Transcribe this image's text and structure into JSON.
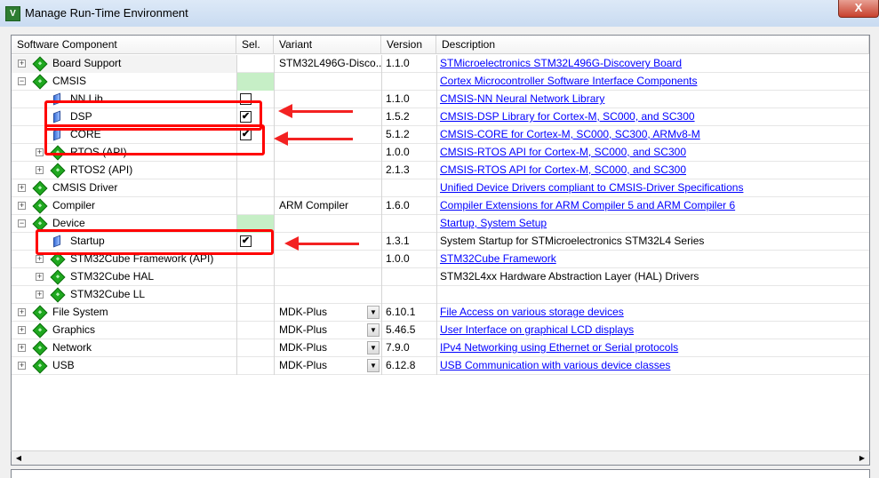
{
  "window": {
    "title": "Manage Run-Time Environment",
    "close_label": "X"
  },
  "columns": {
    "component": "Software Component",
    "sel": "Sel.",
    "variant": "Variant",
    "version": "Version",
    "description": "Description"
  },
  "rows": [
    {
      "name": "Board Support",
      "variant": "STM32L496G-Disco...",
      "version": "1.1.0",
      "description": "STMicroelectronics STM32L496G-Discovery Board",
      "link": true
    },
    {
      "name": "CMSIS",
      "variant": "",
      "version": "",
      "description": "Cortex Microcontroller Software Interface Components",
      "link": true
    },
    {
      "name": "NN Lib",
      "variant": "",
      "version": "1.1.0",
      "description": "CMSIS-NN Neural Network Library",
      "link": true
    },
    {
      "name": "DSP",
      "variant": "",
      "version": "1.5.2",
      "description": "CMSIS-DSP Library for Cortex-M, SC000, and SC300",
      "link": true,
      "checked": true
    },
    {
      "name": "CORE",
      "variant": "",
      "version": "5.1.2",
      "description": "CMSIS-CORE for Cortex-M, SC000, SC300, ARMv8-M",
      "link": true,
      "checked": true
    },
    {
      "name": "RTOS (API)",
      "variant": "",
      "version": "1.0.0",
      "description": "CMSIS-RTOS API for Cortex-M, SC000, and SC300",
      "link": true
    },
    {
      "name": "RTOS2 (API)",
      "variant": "",
      "version": "2.1.3",
      "description": "CMSIS-RTOS API for Cortex-M, SC000, and SC300",
      "link": true
    },
    {
      "name": "CMSIS Driver",
      "variant": "",
      "version": "",
      "description": "Unified Device Drivers compliant to CMSIS-Driver Specifications",
      "link": true
    },
    {
      "name": "Compiler",
      "variant": "ARM Compiler",
      "version": "1.6.0",
      "description": "Compiler Extensions for ARM Compiler 5 and ARM Compiler 6",
      "link": true
    },
    {
      "name": "Device",
      "variant": "",
      "version": "",
      "description": "Startup, System Setup",
      "link": true
    },
    {
      "name": "Startup",
      "variant": "",
      "version": "1.3.1",
      "description": "System Startup for STMicroelectronics STM32L4 Series",
      "link": false,
      "checked": true
    },
    {
      "name": "STM32Cube Framework (API)",
      "variant": "",
      "version": "1.0.0",
      "description": "STM32Cube Framework",
      "link": true
    },
    {
      "name": "STM32Cube HAL",
      "variant": "",
      "version": "",
      "description": "STM32L4xx Hardware Abstraction Layer (HAL) Drivers",
      "link": false
    },
    {
      "name": "STM32Cube LL",
      "variant": "",
      "version": "",
      "description": "",
      "link": false
    },
    {
      "name": "File System",
      "variant": "MDK-Plus",
      "version": "6.10.1",
      "description": "File Access on various storage devices",
      "link": true
    },
    {
      "name": "Graphics",
      "variant": "MDK-Plus",
      "version": "5.46.5",
      "description": "User Interface on graphical LCD displays",
      "link": true
    },
    {
      "name": "Network",
      "variant": "MDK-Plus",
      "version": "7.9.0",
      "description": "IPv4 Networking using Ethernet or Serial protocols",
      "link": true
    },
    {
      "name": "USB",
      "variant": "MDK-Plus",
      "version": "6.12.8",
      "description": "USB Communication with various device classes",
      "link": true
    }
  ],
  "highlight_color": "#ff0000"
}
